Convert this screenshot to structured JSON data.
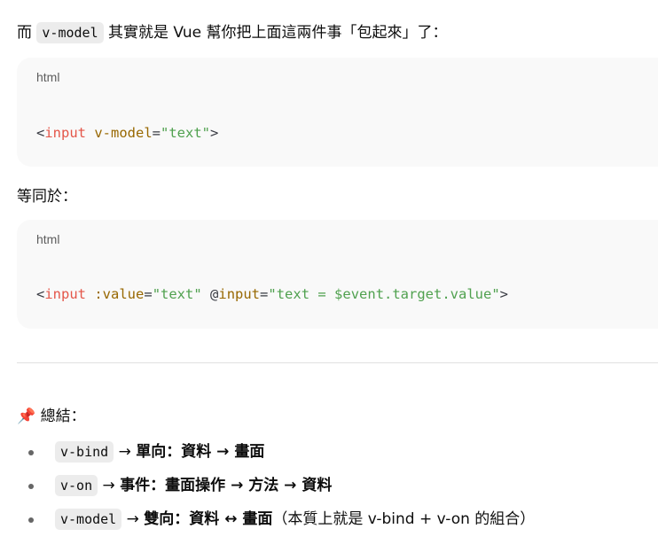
{
  "intro": {
    "prefix": "而",
    "code": "v-model",
    "suffix": "其實就是 Vue 幫你把上面這兩件事「包起來」了："
  },
  "code_block_1": {
    "lang": "html",
    "lt": "<",
    "tag": "input",
    "attr": " v-model",
    "eq": "=",
    "str": "\"text\"",
    "gt": ">"
  },
  "equiv": "等同於：",
  "code_block_2": {
    "lang": "html",
    "lt": "<",
    "tag": "input",
    "attr1": " :value",
    "eq1": "=",
    "str1": "\"text\"",
    "at": " @",
    "attr2": "input",
    "eq2": "=",
    "str2": "\"text = $event.target.value\"",
    "gt": ">"
  },
  "summary": {
    "icon": "📌",
    "title": "總結："
  },
  "items": [
    {
      "code": "v-bind",
      "arrow": " → ",
      "bold": "單向：資料 → 畫面",
      "rest": ""
    },
    {
      "code": "v-on",
      "arrow": " → ",
      "bold": "事件：畫面操作 → 方法 → 資料",
      "rest": ""
    },
    {
      "code": "v-model",
      "arrow": " → ",
      "bold": "雙向：資料 ↔ 畫面",
      "rest": "（本質上就是 v-bind + v-on 的組合）"
    }
  ]
}
